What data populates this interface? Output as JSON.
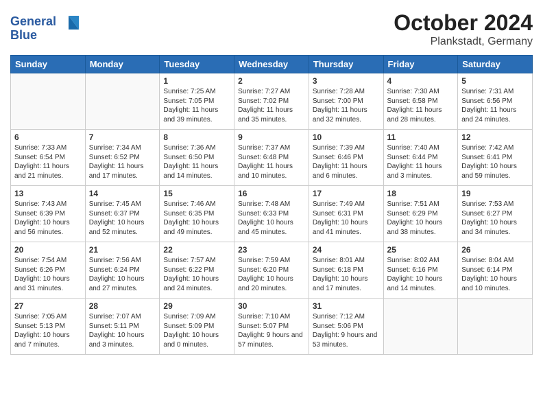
{
  "logo": {
    "line1": "General",
    "line2": "Blue"
  },
  "title": "October 2024",
  "location": "Plankstadt, Germany",
  "headers": [
    "Sunday",
    "Monday",
    "Tuesday",
    "Wednesday",
    "Thursday",
    "Friday",
    "Saturday"
  ],
  "weeks": [
    [
      {
        "day": "",
        "content": ""
      },
      {
        "day": "",
        "content": ""
      },
      {
        "day": "1",
        "content": "Sunrise: 7:25 AM\nSunset: 7:05 PM\nDaylight: 11 hours and 39 minutes."
      },
      {
        "day": "2",
        "content": "Sunrise: 7:27 AM\nSunset: 7:02 PM\nDaylight: 11 hours and 35 minutes."
      },
      {
        "day": "3",
        "content": "Sunrise: 7:28 AM\nSunset: 7:00 PM\nDaylight: 11 hours and 32 minutes."
      },
      {
        "day": "4",
        "content": "Sunrise: 7:30 AM\nSunset: 6:58 PM\nDaylight: 11 hours and 28 minutes."
      },
      {
        "day": "5",
        "content": "Sunrise: 7:31 AM\nSunset: 6:56 PM\nDaylight: 11 hours and 24 minutes."
      }
    ],
    [
      {
        "day": "6",
        "content": "Sunrise: 7:33 AM\nSunset: 6:54 PM\nDaylight: 11 hours and 21 minutes."
      },
      {
        "day": "7",
        "content": "Sunrise: 7:34 AM\nSunset: 6:52 PM\nDaylight: 11 hours and 17 minutes."
      },
      {
        "day": "8",
        "content": "Sunrise: 7:36 AM\nSunset: 6:50 PM\nDaylight: 11 hours and 14 minutes."
      },
      {
        "day": "9",
        "content": "Sunrise: 7:37 AM\nSunset: 6:48 PM\nDaylight: 11 hours and 10 minutes."
      },
      {
        "day": "10",
        "content": "Sunrise: 7:39 AM\nSunset: 6:46 PM\nDaylight: 11 hours and 6 minutes."
      },
      {
        "day": "11",
        "content": "Sunrise: 7:40 AM\nSunset: 6:44 PM\nDaylight: 11 hours and 3 minutes."
      },
      {
        "day": "12",
        "content": "Sunrise: 7:42 AM\nSunset: 6:41 PM\nDaylight: 10 hours and 59 minutes."
      }
    ],
    [
      {
        "day": "13",
        "content": "Sunrise: 7:43 AM\nSunset: 6:39 PM\nDaylight: 10 hours and 56 minutes."
      },
      {
        "day": "14",
        "content": "Sunrise: 7:45 AM\nSunset: 6:37 PM\nDaylight: 10 hours and 52 minutes."
      },
      {
        "day": "15",
        "content": "Sunrise: 7:46 AM\nSunset: 6:35 PM\nDaylight: 10 hours and 49 minutes."
      },
      {
        "day": "16",
        "content": "Sunrise: 7:48 AM\nSunset: 6:33 PM\nDaylight: 10 hours and 45 minutes."
      },
      {
        "day": "17",
        "content": "Sunrise: 7:49 AM\nSunset: 6:31 PM\nDaylight: 10 hours and 41 minutes."
      },
      {
        "day": "18",
        "content": "Sunrise: 7:51 AM\nSunset: 6:29 PM\nDaylight: 10 hours and 38 minutes."
      },
      {
        "day": "19",
        "content": "Sunrise: 7:53 AM\nSunset: 6:27 PM\nDaylight: 10 hours and 34 minutes."
      }
    ],
    [
      {
        "day": "20",
        "content": "Sunrise: 7:54 AM\nSunset: 6:26 PM\nDaylight: 10 hours and 31 minutes."
      },
      {
        "day": "21",
        "content": "Sunrise: 7:56 AM\nSunset: 6:24 PM\nDaylight: 10 hours and 27 minutes."
      },
      {
        "day": "22",
        "content": "Sunrise: 7:57 AM\nSunset: 6:22 PM\nDaylight: 10 hours and 24 minutes."
      },
      {
        "day": "23",
        "content": "Sunrise: 7:59 AM\nSunset: 6:20 PM\nDaylight: 10 hours and 20 minutes."
      },
      {
        "day": "24",
        "content": "Sunrise: 8:01 AM\nSunset: 6:18 PM\nDaylight: 10 hours and 17 minutes."
      },
      {
        "day": "25",
        "content": "Sunrise: 8:02 AM\nSunset: 6:16 PM\nDaylight: 10 hours and 14 minutes."
      },
      {
        "day": "26",
        "content": "Sunrise: 8:04 AM\nSunset: 6:14 PM\nDaylight: 10 hours and 10 minutes."
      }
    ],
    [
      {
        "day": "27",
        "content": "Sunrise: 7:05 AM\nSunset: 5:13 PM\nDaylight: 10 hours and 7 minutes."
      },
      {
        "day": "28",
        "content": "Sunrise: 7:07 AM\nSunset: 5:11 PM\nDaylight: 10 hours and 3 minutes."
      },
      {
        "day": "29",
        "content": "Sunrise: 7:09 AM\nSunset: 5:09 PM\nDaylight: 10 hours and 0 minutes."
      },
      {
        "day": "30",
        "content": "Sunrise: 7:10 AM\nSunset: 5:07 PM\nDaylight: 9 hours and 57 minutes."
      },
      {
        "day": "31",
        "content": "Sunrise: 7:12 AM\nSunset: 5:06 PM\nDaylight: 9 hours and 53 minutes."
      },
      {
        "day": "",
        "content": ""
      },
      {
        "day": "",
        "content": ""
      }
    ]
  ]
}
